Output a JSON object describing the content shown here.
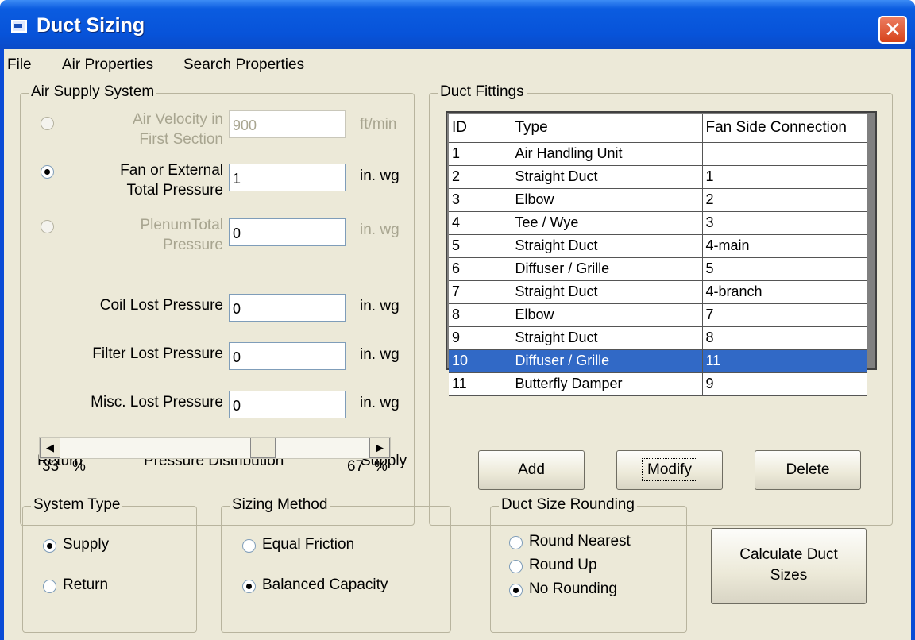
{
  "window": {
    "title": "Duct Sizing",
    "close_glyph": "✕"
  },
  "menu": [
    "File",
    "Air Properties",
    "Search Properties"
  ],
  "air_supply": {
    "legend": "Air Supply System",
    "velocity": {
      "label_line1": "Air Velocity in",
      "label_line2": "First Section",
      "value": "900",
      "unit": "ft/min"
    },
    "fan": {
      "label_line1": "Fan or External",
      "label_line2": "Total Pressure",
      "value": "1",
      "unit": "in. wg"
    },
    "plenum": {
      "label_line1": "PlenumTotal",
      "label_line2": "Pressure",
      "value": "0",
      "unit": "in. wg"
    },
    "coil": {
      "label": "Coil Lost Pressure",
      "value": "0",
      "unit": "in. wg"
    },
    "filter": {
      "label": "Filter Lost Pressure",
      "value": "0",
      "unit": "in. wg"
    },
    "misc": {
      "label": "Misc. Lost Pressure",
      "value": "0",
      "unit": "in. wg"
    },
    "distribution": {
      "left_label": "Return",
      "center_label": "Pressure Distribution",
      "right_label": "Supply",
      "left_value": "33",
      "right_value": "67",
      "percent": "%",
      "position_fraction": 0.67
    }
  },
  "fittings": {
    "legend": "Duct Fittings",
    "columns": [
      "ID",
      "Type",
      "Fan Side Connection"
    ],
    "rows": [
      [
        "1",
        "Air Handling Unit",
        ""
      ],
      [
        "2",
        "Straight Duct",
        "1"
      ],
      [
        "3",
        "Elbow",
        "2"
      ],
      [
        "4",
        "Tee / Wye",
        "3"
      ],
      [
        "5",
        "Straight Duct",
        "4-main"
      ],
      [
        "6",
        "Diffuser / Grille",
        "5"
      ],
      [
        "7",
        "Straight Duct",
        "4-branch"
      ],
      [
        "8",
        "Elbow",
        "7"
      ],
      [
        "9",
        "Straight Duct",
        "8"
      ],
      [
        "10",
        "Diffuser / Grille",
        "11"
      ],
      [
        "11",
        "Butterfly Damper",
        "9"
      ]
    ],
    "selected_row": 9,
    "buttons": {
      "add": "Add",
      "modify": "Modify",
      "delete": "Delete"
    }
  },
  "system_type": {
    "legend": "System Type",
    "supply": "Supply",
    "return": "Return",
    "selected": "supply"
  },
  "sizing_method": {
    "legend": "Sizing Method",
    "equal_friction": "Equal Friction",
    "balanced_capacity": "Balanced Capacity",
    "selected": "balanced_capacity"
  },
  "rounding": {
    "legend": "Duct Size Rounding",
    "nearest": "Round Nearest",
    "up": "Round Up",
    "none": "No Rounding",
    "selected": "none"
  },
  "calculate": {
    "line1": "Calculate Duct",
    "line2": "Sizes"
  },
  "arrows": {
    "left": "◀",
    "right": "▶"
  }
}
